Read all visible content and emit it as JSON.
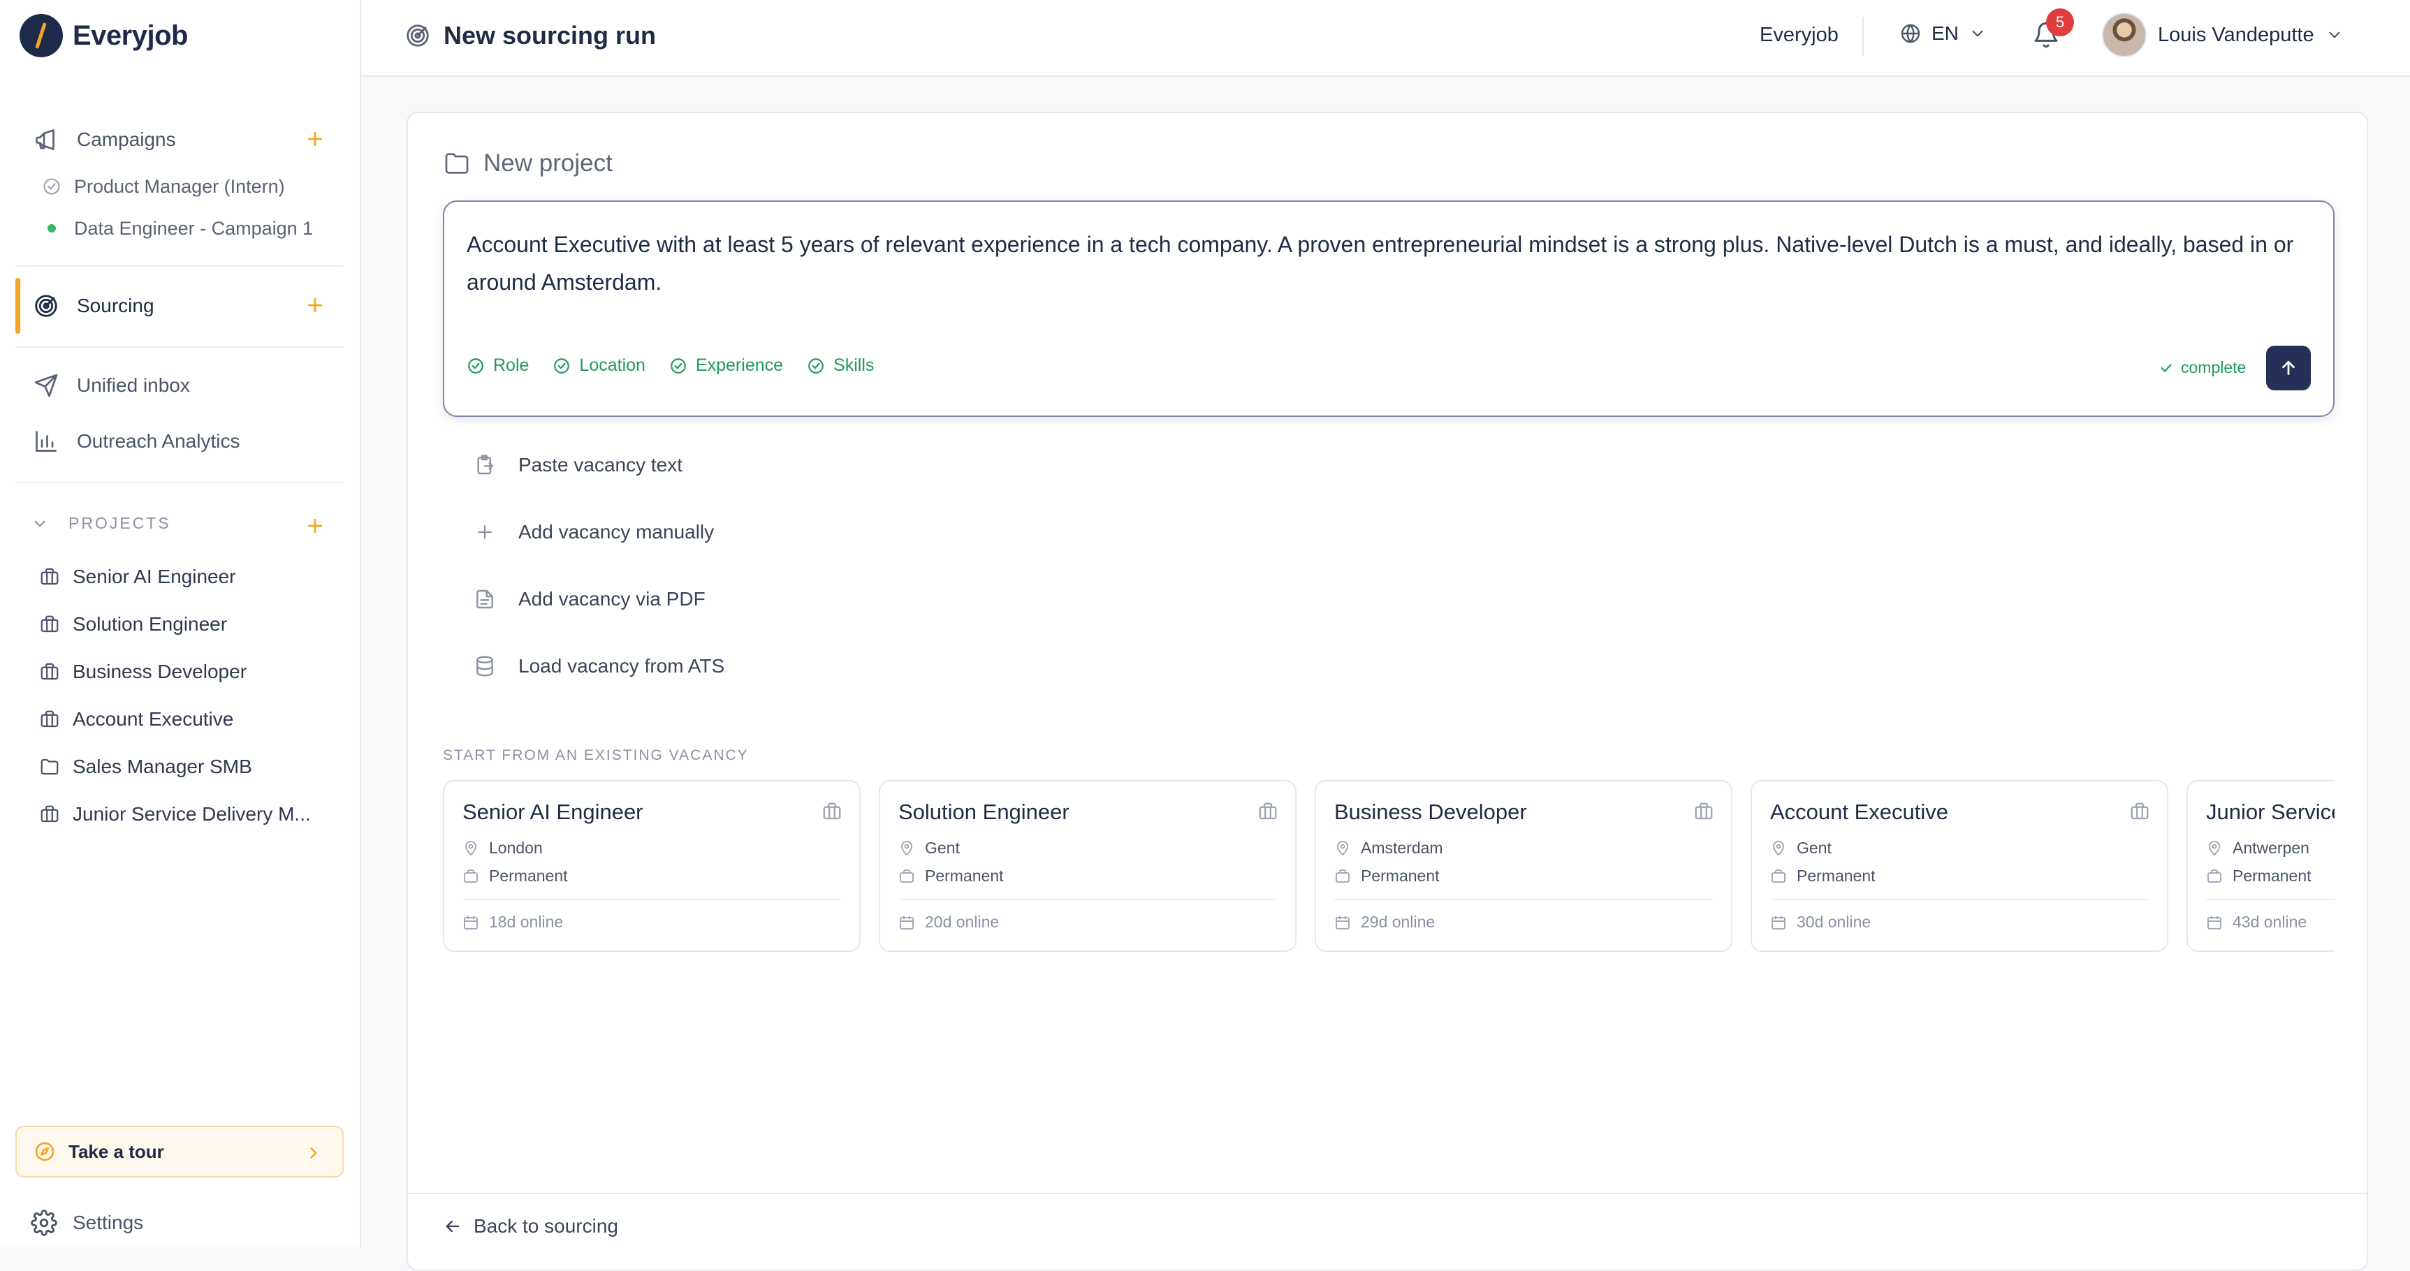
{
  "app": {
    "name": "Everyjob"
  },
  "sidebar": {
    "campaigns": {
      "label": "Campaigns",
      "items": [
        {
          "label": "Product Manager (Intern)"
        },
        {
          "label": "Data Engineer - Campaign 1"
        }
      ]
    },
    "sourcing": {
      "label": "Sourcing"
    },
    "unified_inbox": {
      "label": "Unified inbox"
    },
    "outreach_analytics": {
      "label": "Outreach Analytics"
    },
    "projects": {
      "label": "PROJECTS",
      "items": [
        {
          "label": "Senior AI Engineer"
        },
        {
          "label": "Solution Engineer"
        },
        {
          "label": "Business Developer"
        },
        {
          "label": "Account Executive"
        },
        {
          "label": "Sales Manager SMB"
        },
        {
          "label": "Junior Service Delivery M..."
        }
      ]
    },
    "tour": {
      "label": "Take a tour"
    },
    "settings": {
      "label": "Settings"
    }
  },
  "header": {
    "title": "New sourcing run",
    "org": "Everyjob",
    "language": "EN",
    "notifications_count": "5",
    "user_name": "Louis Vandeputte"
  },
  "project": {
    "heading": "New project",
    "prompt_text": "Account Executive with at least 5 years of relevant experience in a tech company. A proven entrepreneurial mindset is a strong plus. Native-level Dutch is a must, and ideally, based in or around Amsterdam.",
    "criteria": [
      "Role",
      "Location",
      "Experience",
      "Skills"
    ],
    "status": "complete"
  },
  "options": [
    {
      "label": "Paste vacancy text"
    },
    {
      "label": "Add vacancy manually"
    },
    {
      "label": "Add vacancy via PDF"
    },
    {
      "label": "Load vacancy from ATS"
    }
  ],
  "existing": {
    "label": "START FROM AN EXISTING VACANCY",
    "vacancies": [
      {
        "title": "Senior AI Engineer",
        "location": "London",
        "type": "Permanent",
        "online": "18d online"
      },
      {
        "title": "Solution Engineer",
        "location": "Gent",
        "type": "Permanent",
        "online": "20d online"
      },
      {
        "title": "Business Developer",
        "location": "Amsterdam",
        "type": "Permanent",
        "online": "29d online"
      },
      {
        "title": "Account Executive",
        "location": "Gent",
        "type": "Permanent",
        "online": "30d online"
      },
      {
        "title": "Junior Service Delivery Manager",
        "location": "Antwerpen",
        "type": "Permanent",
        "online": "43d online"
      }
    ]
  },
  "footer": {
    "back_label": "Back to sourcing"
  },
  "colors": {
    "accent": "#f5a524",
    "brand": "#1e2a4a",
    "success": "#1f9a59",
    "badge": "#e23b3b"
  }
}
